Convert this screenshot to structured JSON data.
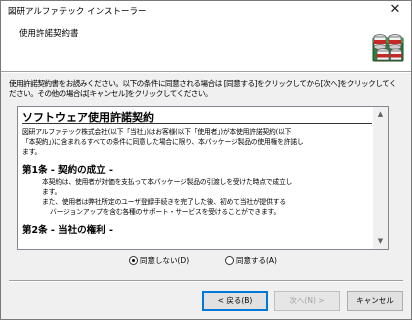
{
  "window": {
    "title": "図研アルファテック インストーラー",
    "close_glyph": "✕"
  },
  "header": {
    "title": "使用許諾契約書"
  },
  "instructions": {
    "line1": "使用許諾契約書をお読みください。以下の条件に同意される場合は [同意する]をクリックしてから[次へ]をクリックしてく",
    "line2": "ださい。その他の場合は[キャンセル]をクリックしてください。"
  },
  "license": {
    "title": "ソフトウェア使用許諾契約",
    "intro1": "図研アルファテック株式会社(以下「当社」)はお客様(以下「使用者」)が本使用許諾契約(以下",
    "intro2": "「本契約」)に含まれるすべての条件に同意した場合に限り、本パッケージ製品の使用権を許諾し",
    "intro3": "ます。",
    "article1_heading": "第1条 - 契約の成立 -",
    "article1_p1a": "本契約は、使用者が対価を支払って本パッケージ製品の引渡しを受けた時点で成立し",
    "article1_p1b": "ます。",
    "article1_p2a": "また、使用者は弊社所定のユーザ登録手続きを完了した後、初めて当社が提供する",
    "article1_p2b": "バージョンアップを含む各種のサポート・サービスを受けることができます。",
    "article2_heading": "第2条 - 当社の権利 -"
  },
  "radios": {
    "disagree_label": "同意しない(D)",
    "agree_label": "同意する(A)",
    "selected": "disagree"
  },
  "buttons": {
    "back": "< 戻る(B)",
    "next": "次へ(N) >",
    "cancel": "キャンセル"
  },
  "colors": {
    "focus_blue": "#0078d7"
  }
}
